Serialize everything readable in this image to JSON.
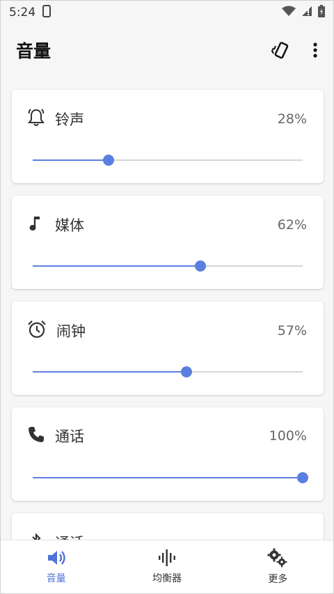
{
  "status_bar": {
    "time": "5:24"
  },
  "header": {
    "title": "音量"
  },
  "colors": {
    "accent": "#5b7fe0",
    "track": "#d6d6d6"
  },
  "cards": [
    {
      "icon": "bell-icon",
      "label": "铃声",
      "percent_text": "28%",
      "level": 0.28
    },
    {
      "icon": "music-note-icon",
      "label": "媒体",
      "percent_text": "62%",
      "level": 0.62
    },
    {
      "icon": "alarm-clock-icon",
      "label": "闹钟",
      "percent_text": "57%",
      "level": 0.57
    },
    {
      "icon": "phone-icon",
      "label": "通话",
      "percent_text": "100%",
      "level": 1.0
    },
    {
      "icon": "bluetooth-icon",
      "label": "通话",
      "percent_text": "",
      "level": null
    }
  ],
  "bottom_nav": [
    {
      "icon": "volume-icon",
      "label": "音量",
      "active": true
    },
    {
      "icon": "equalizer-icon",
      "label": "均衡器",
      "active": false
    },
    {
      "icon": "gears-icon",
      "label": "更多",
      "active": false
    }
  ]
}
